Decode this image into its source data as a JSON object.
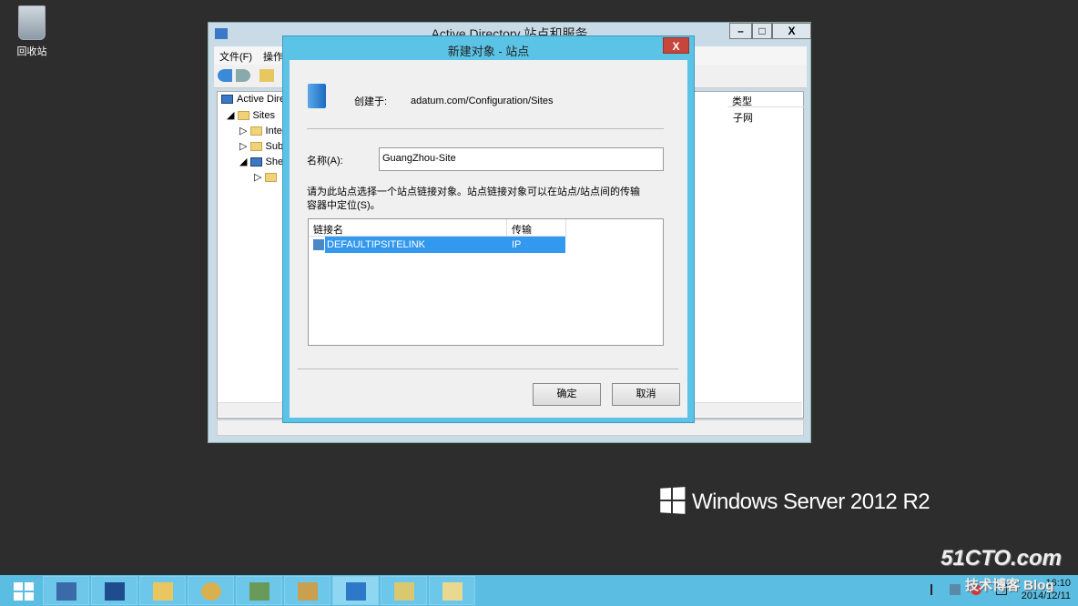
{
  "desktop": {
    "recycle_bin_label": "回收站",
    "brand": "Windows Server 2012 R2",
    "watermark": "51CTO.com",
    "watermark_sub": "技术博客 Blog"
  },
  "mmc": {
    "title": "Active Directory 站点和服务",
    "menu": [
      "文件(F)",
      "操作"
    ],
    "tree": [
      {
        "label": "Active Dire"
      },
      {
        "label": "Sites"
      },
      {
        "label": "Inte"
      },
      {
        "label": "Sub"
      },
      {
        "label": "She"
      }
    ],
    "column_header": "类型",
    "column_value": "子网",
    "window_buttons": [
      "–",
      "□",
      "X"
    ]
  },
  "dialog": {
    "title": "新建对象 - 站点",
    "close": "X",
    "created_in_label": "创建于:",
    "created_in_value": "adatum.com/Configuration/Sites",
    "name_label": "名称(A):",
    "name_value": "GuangZhou-Site",
    "instructions_line1": "请为此站点选择一个站点链接对象。站点链接对象可以在站点/站点间的传输",
    "instructions_line2": "容器中定位(S)。",
    "list_columns": [
      "链接名",
      "传输"
    ],
    "list_rows": [
      {
        "name": "DEFAULTIPSITELINK",
        "transport": "IP",
        "selected": true
      }
    ],
    "ok": "确定",
    "cancel": "取消"
  },
  "taskbar": {
    "icons": [
      "start-icon",
      "server-manager-icon",
      "powershell-icon",
      "file-explorer-icon",
      "task-scheduler-icon",
      "network-icon",
      "ad-users-icon",
      "ad-sites-icon",
      "ad-domains-icon",
      "notepad-icon"
    ],
    "clock_time": "16:10",
    "clock_date": "2014/12/11",
    "accent": "#5bbde2"
  }
}
